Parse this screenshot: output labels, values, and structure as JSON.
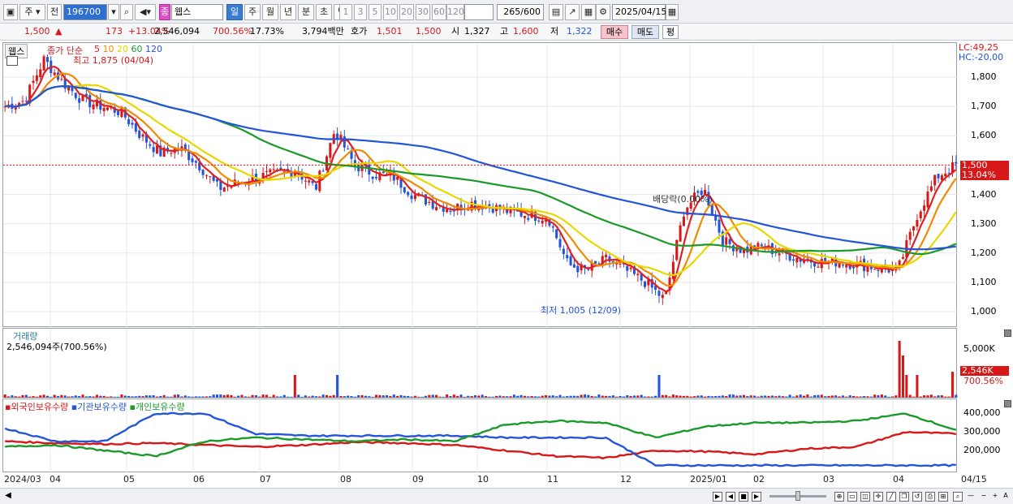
{
  "toolbar": {
    "type_label": "주",
    "prev_label": "전",
    "code": "196700",
    "name_badge": "종",
    "name": "웹스",
    "periods": [
      "일",
      "주",
      "월",
      "년",
      "분",
      "초",
      "틱"
    ],
    "active_period": "일",
    "minutes": [
      "1",
      "3",
      "5",
      "10",
      "20",
      "30",
      "60",
      "120"
    ],
    "count": "265",
    "count_total": "/600",
    "date": "2025/04/15"
  },
  "quote": {
    "price": "1,500",
    "arrow": "▲",
    "change": "173",
    "change_pct": "+13.04%",
    "volume": "2,546,094",
    "volume_pct": "700.56%",
    "turnover": "17.73%",
    "amount": "3,794백만",
    "bid_label": "호가",
    "bid1": "1,501",
    "bid2": "1,500",
    "open_label": "시",
    "open": "1,327",
    "high_label": "고",
    "high": "1,600",
    "low_label": "저",
    "low": "1,322",
    "buy_label": "매수",
    "sell_label": "매도",
    "eval_label": "평"
  },
  "price_panel": {
    "name": "웹스",
    "legend_title": "종가 단순",
    "ma_periods": [
      "5",
      "10",
      "20",
      "60",
      "120"
    ],
    "ma_colors": [
      "#e02020",
      "#f08a00",
      "#e8d800",
      "#1a9a2a",
      "#2455d8"
    ],
    "annot_high": "최고 1,875 (04/04)",
    "annot_low": "최저 1,005 (12/09)",
    "annot_dividend": "배당락(0.00%)",
    "lc": "LC:49,25",
    "hc": "HC:-20,00",
    "y_ticks": [
      "1,800",
      "1,700",
      "1,600",
      "1,500",
      "1,400",
      "1,300",
      "1,200",
      "1,100",
      "1,000"
    ],
    "current_price": "1,500",
    "current_pct": "13.04%"
  },
  "volume_panel": {
    "title": "거래량",
    "value": "2,546,094주(700.56%)",
    "y_tick": "5,000K",
    "current": "2,546K",
    "current_pct": "700.56%"
  },
  "holding_panel": {
    "legend": [
      "외국인보유수량",
      "기관보유수량",
      "개인보유수량"
    ],
    "legend_colors": [
      "#d81818",
      "#2455d8",
      "#1a9a2a"
    ],
    "y_ticks": [
      "400,000",
      "300,000",
      "200,000"
    ]
  },
  "x_axis": [
    "2024/03",
    "04",
    "05",
    "06",
    "07",
    "08",
    "09",
    "10",
    "11",
    "12",
    "2025/01",
    "02",
    "03",
    "04"
  ],
  "x_axis_right": "04/15",
  "chart_data": {
    "type": "line",
    "title": "",
    "series": [
      {
        "name": "웹스",
        "values": [
          1700,
          1720,
          1860,
          1780,
          1720,
          1700,
          1680,
          1600,
          1540,
          1560,
          1500,
          1420,
          1440,
          1460,
          1470,
          1480,
          1420,
          1620,
          1500,
          1470,
          1460,
          1400,
          1370,
          1350,
          1370,
          1360,
          1340,
          1330,
          1320,
          1160,
          1140,
          1180,
          1140,
          1100,
          1040,
          1350,
          1420,
          1240,
          1210,
          1220,
          1200,
          1180,
          1170,
          1170,
          1160,
          1150,
          1140,
          1330,
          1460,
          1500
        ]
      },
      {
        "name": "120",
        "values": [
          1850,
          1840,
          1820,
          1800,
          1770,
          1740,
          1710,
          1680,
          1650,
          1620,
          1590,
          1560,
          1530,
          1500,
          1470,
          1440,
          1410,
          1390,
          1370,
          1350,
          1330,
          1310,
          1300,
          1290,
          1280,
          1270,
          1260,
          1250,
          1240,
          1230,
          1220,
          1210,
          1220,
          1230
        ]
      }
    ],
    "ylim": [
      1000,
      1800
    ],
    "y_ticks": [
      1000,
      1100,
      1200,
      1300,
      1400,
      1500,
      1600,
      1700,
      1800
    ]
  }
}
